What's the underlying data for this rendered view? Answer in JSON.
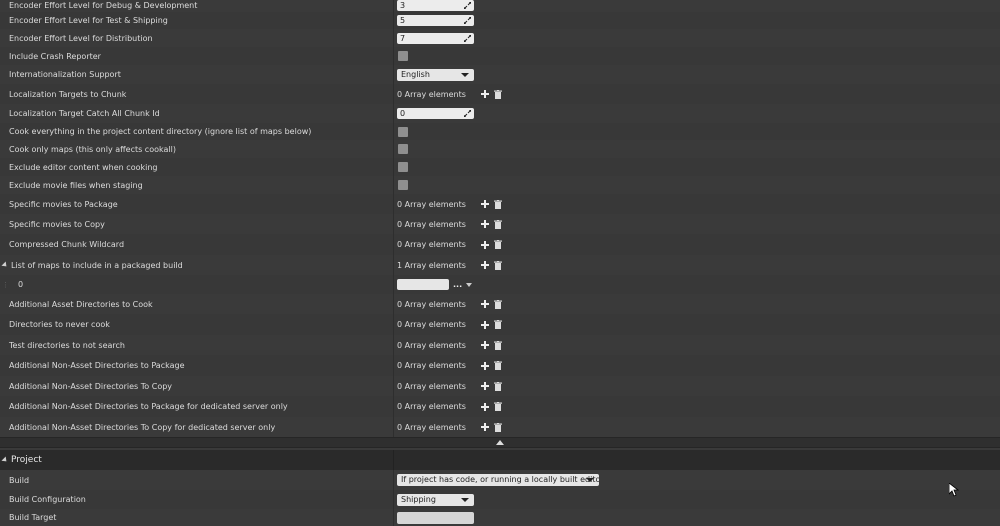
{
  "packaging": {
    "encoder_debug": {
      "label": "Encoder Effort Level for Debug & Development",
      "value": "3"
    },
    "encoder_test": {
      "label": "Encoder Effort Level for Test & Shipping",
      "value": "5"
    },
    "encoder_dist": {
      "label": "Encoder Effort Level for Distribution",
      "value": "7"
    },
    "crash_reporter": {
      "label": "Include Crash Reporter"
    },
    "i18n": {
      "label": "Internationalization Support",
      "value": "English"
    },
    "loc_targets": {
      "label": "Localization Targets to Chunk",
      "value": "0 Array elements"
    },
    "loc_catchall": {
      "label": "Localization Target Catch All Chunk Id",
      "value": "0"
    },
    "cook_everything": {
      "label": "Cook everything in the project content directory (ignore list of maps below)"
    },
    "cook_only_maps": {
      "label": "Cook only maps (this only affects cookall)"
    },
    "exclude_editor": {
      "label": "Exclude editor content when cooking"
    },
    "exclude_movies": {
      "label": "Exclude movie files when staging"
    },
    "movies_package": {
      "label": "Specific movies to Package",
      "value": "0 Array elements"
    },
    "movies_copy": {
      "label": "Specific movies to Copy",
      "value": "0 Array elements"
    },
    "chunk_wildcard": {
      "label": "Compressed Chunk Wildcard",
      "value": "0 Array elements"
    },
    "maps_list": {
      "label": "List of maps to include in a packaged build",
      "value": "1 Array elements"
    },
    "maps_item0": {
      "label": "0",
      "ellipsis": "..."
    },
    "asset_dirs_cook": {
      "label": "Additional Asset Directories to Cook",
      "value": "0 Array elements"
    },
    "dirs_never_cook": {
      "label": "Directories to never cook",
      "value": "0 Array elements"
    },
    "test_dirs": {
      "label": "Test directories to not search",
      "value": "0 Array elements"
    },
    "nonasset_package": {
      "label": "Additional Non-Asset Directories to Package",
      "value": "0 Array elements"
    },
    "nonasset_copy": {
      "label": "Additional Non-Asset Directories To Copy",
      "value": "0 Array elements"
    },
    "nonasset_package_ds": {
      "label": "Additional Non-Asset Directories to Package for dedicated server only",
      "value": "0 Array elements"
    },
    "nonasset_copy_ds": {
      "label": "Additional Non-Asset Directories To Copy for dedicated server only",
      "value": "0 Array elements"
    }
  },
  "project": {
    "header": "Project",
    "build": {
      "label": "Build",
      "value": "If project has code, or running a locally built editor"
    },
    "build_config": {
      "label": "Build Configuration",
      "value": "Shipping"
    },
    "build_target": {
      "label": "Build Target",
      "value": ""
    }
  },
  "colors": {
    "background": "#3a3a3a",
    "header": "#2a2a2a",
    "field": "#ececec"
  }
}
